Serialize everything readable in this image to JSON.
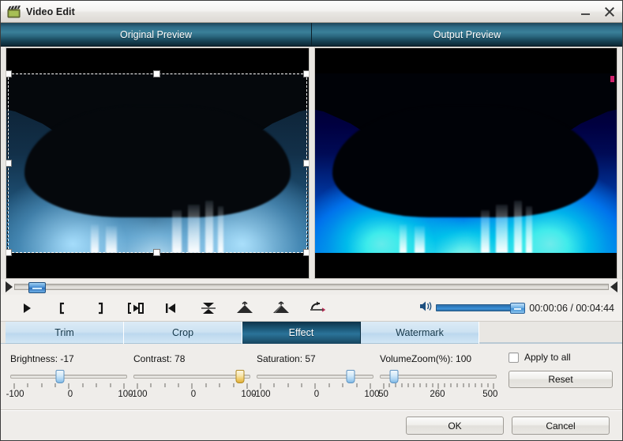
{
  "window": {
    "title": "Video Edit",
    "icon": "clapperboard-icon",
    "minimize_label": "Minimize",
    "close_label": "Close"
  },
  "previews": {
    "original_label": "Original Preview",
    "output_label": "Output Preview"
  },
  "transport": {
    "seek_position_pct": 2.3,
    "buttons": [
      {
        "name": "play-button",
        "icon": "play-icon",
        "label": "Play"
      },
      {
        "name": "set-start-button",
        "icon": "bracket-left-icon",
        "label": "Set start time"
      },
      {
        "name": "set-end-button",
        "icon": "bracket-right-icon",
        "label": "Set end time"
      },
      {
        "name": "play-segment-button",
        "icon": "bracket-play-icon",
        "label": "Play segment"
      },
      {
        "name": "previous-frame-button",
        "icon": "skip-previous-icon",
        "label": "Previous frame"
      },
      {
        "name": "flip-vertical-button",
        "icon": "flip-vertical-icon",
        "label": "Flip vertical"
      },
      {
        "name": "rotate-left-button",
        "icon": "rotate-left-icon",
        "label": "Rotate left"
      },
      {
        "name": "rotate-right-button",
        "icon": "rotate-right-icon",
        "label": "Rotate right"
      },
      {
        "name": "undo-button",
        "icon": "undo-icon",
        "label": "Undo"
      }
    ],
    "volume_icon": "speaker-icon",
    "volume_pct": 100,
    "current_time": "00:00:06",
    "total_time": "00:04:44",
    "time_separator": "/",
    "time_display": "00:00:06 / 00:04:44"
  },
  "tabs": [
    {
      "label": "Trim",
      "active": false
    },
    {
      "label": "Crop",
      "active": false
    },
    {
      "label": "Effect",
      "active": true
    },
    {
      "label": "Watermark",
      "active": false
    }
  ],
  "effect": {
    "sliders": [
      {
        "name": "brightness",
        "label": "Brightness: -17",
        "title": "Brightness",
        "value": -17,
        "min": -100,
        "max": 100,
        "thumb_pct": 41.5,
        "thumb_color": "#aed5f2",
        "scale_labels": [
          "-100",
          "0",
          "100"
        ],
        "scale_pcts": [
          4,
          50,
          96
        ],
        "tick_count": 9
      },
      {
        "name": "contrast",
        "label": "Contrast: 78",
        "title": "Contrast",
        "value": 78,
        "min": -100,
        "max": 100,
        "thumb_pct": 89,
        "thumb_color": "#efcb6a",
        "scale_labels": [
          "-100",
          "0",
          "100"
        ],
        "scale_pcts": [
          4,
          50,
          96
        ],
        "tick_count": 9
      },
      {
        "name": "saturation",
        "label": "Saturation: 57",
        "title": "Saturation",
        "value": 57,
        "min": -100,
        "max": 100,
        "thumb_pct": 78.5,
        "thumb_color": "#aed5f2",
        "scale_labels": [
          "-100",
          "0",
          "100"
        ],
        "scale_pcts": [
          4,
          50,
          96
        ],
        "tick_count": 9
      },
      {
        "name": "volumezoom",
        "label": "VolumeZoom(%): 100",
        "title": "VolumeZoom(%)",
        "value": 100,
        "min": 50,
        "max": 500,
        "thumb_pct": 12,
        "thumb_color": "#aed5f2",
        "scale_labels": [
          "50",
          "260",
          "500"
        ],
        "scale_pcts": [
          3,
          48,
          92
        ],
        "tick_count": 19
      }
    ],
    "apply_to_all_label": "Apply to all",
    "apply_to_all_checked": false,
    "reset_label": "Reset"
  },
  "footer": {
    "ok_label": "OK",
    "cancel_label": "Cancel"
  },
  "colors": {
    "accent": "#2b7399",
    "tab_active_bg": "#1d5b7c",
    "header_gradient_top": "#3a8099",
    "amber_thumb": "#efcb6a",
    "slider_blue": "#aed5f2",
    "window_bg": "#efedea"
  }
}
